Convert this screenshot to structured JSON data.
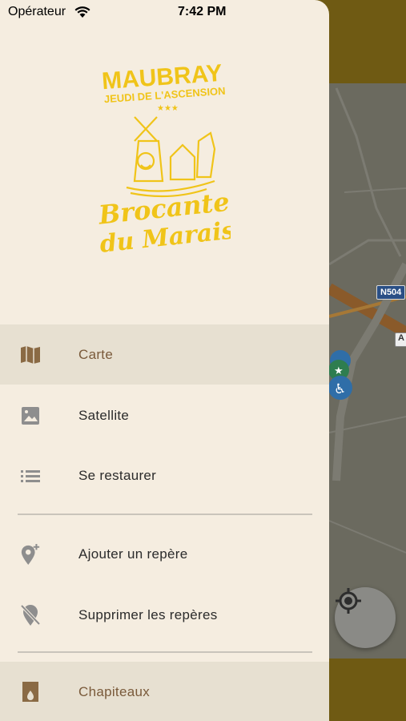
{
  "status_bar": {
    "carrier": "Opérateur",
    "time": "7:42 PM"
  },
  "logo": {
    "line1": "MAUBRAY",
    "line2": "JEUDI DE L'ASCENSION",
    "line3": "Brocante",
    "line4": "du Marais",
    "small": "Brocante du Marais"
  },
  "menu": {
    "section1": [
      {
        "label": "Carte",
        "icon": "map-icon",
        "active": true
      },
      {
        "label": "Satellite",
        "icon": "image-icon",
        "active": false
      },
      {
        "label": "Se restaurer",
        "icon": "list-icon",
        "active": false
      }
    ],
    "section2": [
      {
        "label": "Ajouter un repère",
        "icon": "add-location-icon"
      },
      {
        "label": "Supprimer les repères",
        "icon": "location-off-icon"
      }
    ],
    "section3": [
      {
        "label": "Chapiteaux",
        "icon": "cup-icon",
        "active": true
      }
    ]
  },
  "map": {
    "road_shield": "N504",
    "road_shield_2": "A"
  },
  "colors": {
    "drawer_bg": "#f5ede0",
    "active_bg": "#e7e0d1",
    "accent": "#7a5a3a",
    "logo_yellow": "#f0c419",
    "map_bar": "#6f5a13"
  }
}
